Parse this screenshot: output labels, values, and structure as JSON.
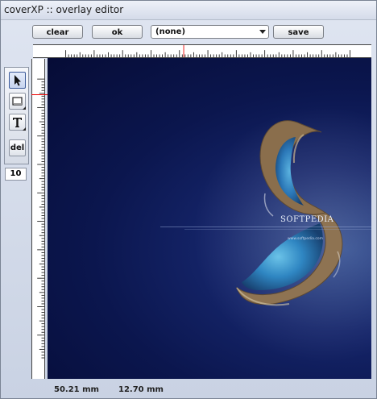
{
  "window": {
    "title": "coverXP :: overlay editor"
  },
  "toolbar": {
    "clear_label": "clear",
    "ok_label": "ok",
    "overlay_select_value": "(none)",
    "save_label": "save"
  },
  "tools": {
    "delete_label": "del",
    "size_value": "10"
  },
  "canvas": {
    "brand_text": "SOFTPEDIA",
    "url_text": "www.softpedia.com"
  },
  "status": {
    "x_readout": "50.21 mm",
    "y_readout": "12.70 mm"
  }
}
